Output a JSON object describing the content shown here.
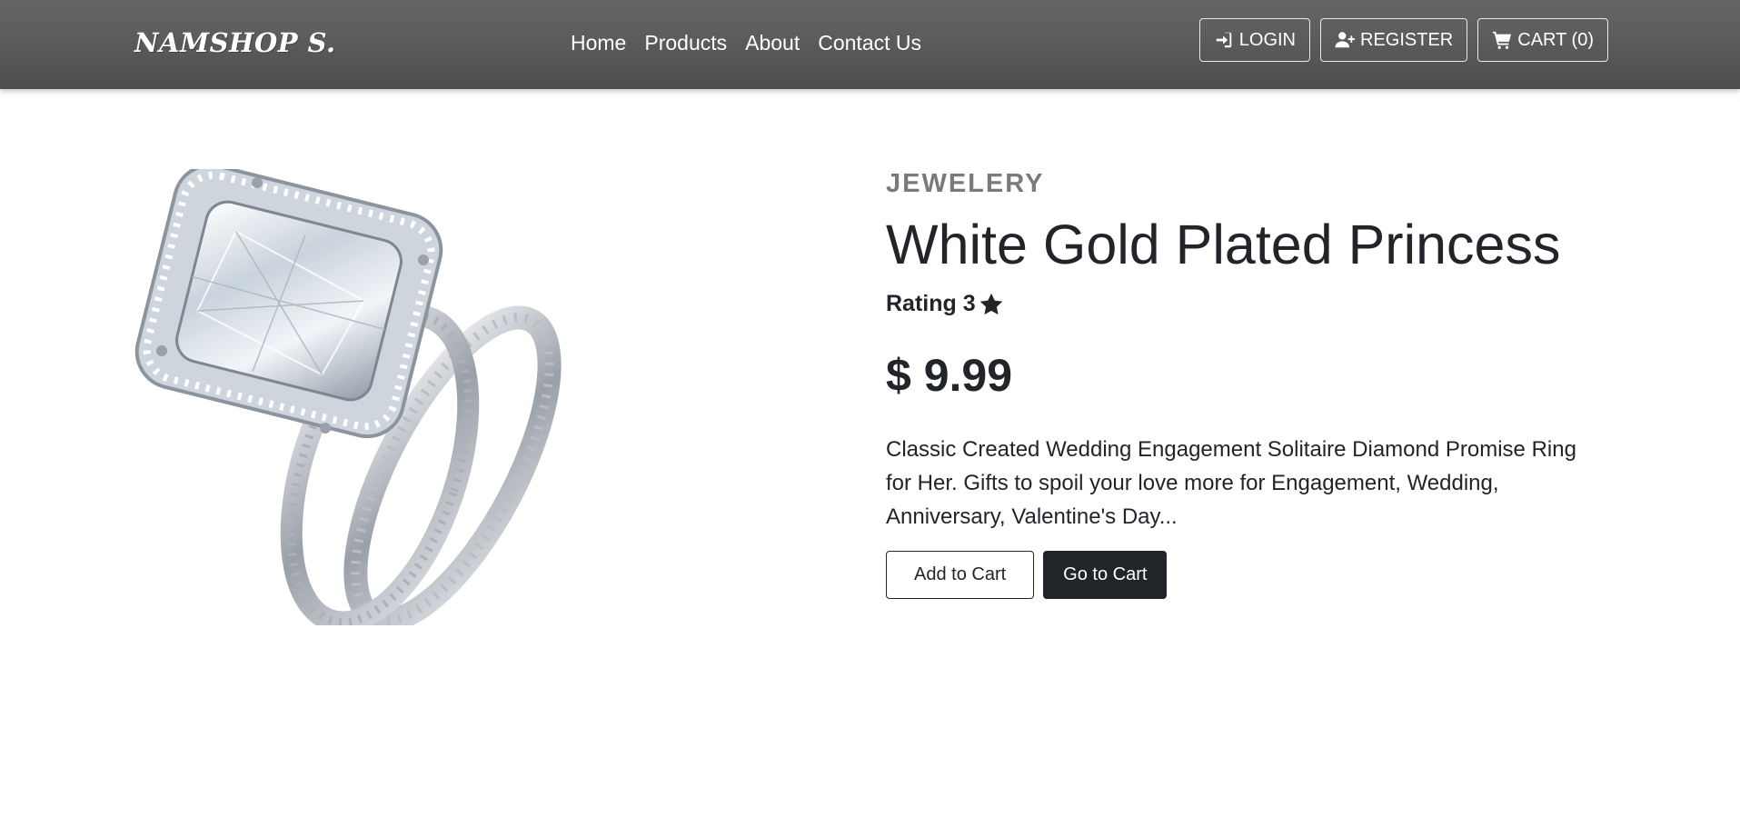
{
  "navbar": {
    "brand": "NAMSHOP S.",
    "links": [
      {
        "label": "Home"
      },
      {
        "label": "Products"
      },
      {
        "label": "About"
      },
      {
        "label": "Contact Us"
      }
    ],
    "login_label": "LOGIN",
    "register_label": "REGISTER",
    "cart_label": "CART (0)",
    "icons": {
      "login": "sign-in-icon",
      "register": "user-plus-icon",
      "cart": "shopping-cart-icon"
    }
  },
  "product": {
    "category": "JEWELERY",
    "title": "White Gold Plated Princess",
    "rating_label": "Rating 3",
    "rating_value": 3,
    "rating_icon": "star-icon",
    "price": "$ 9.99",
    "description": "Classic Created Wedding Engagement Solitaire Diamond Promise Ring for Her. Gifts to spoil your love more for Engagement, Wedding, Anniversary, Valentine's Day...",
    "add_to_cart_label": "Add to Cart",
    "go_to_cart_label": "Go to Cart"
  }
}
